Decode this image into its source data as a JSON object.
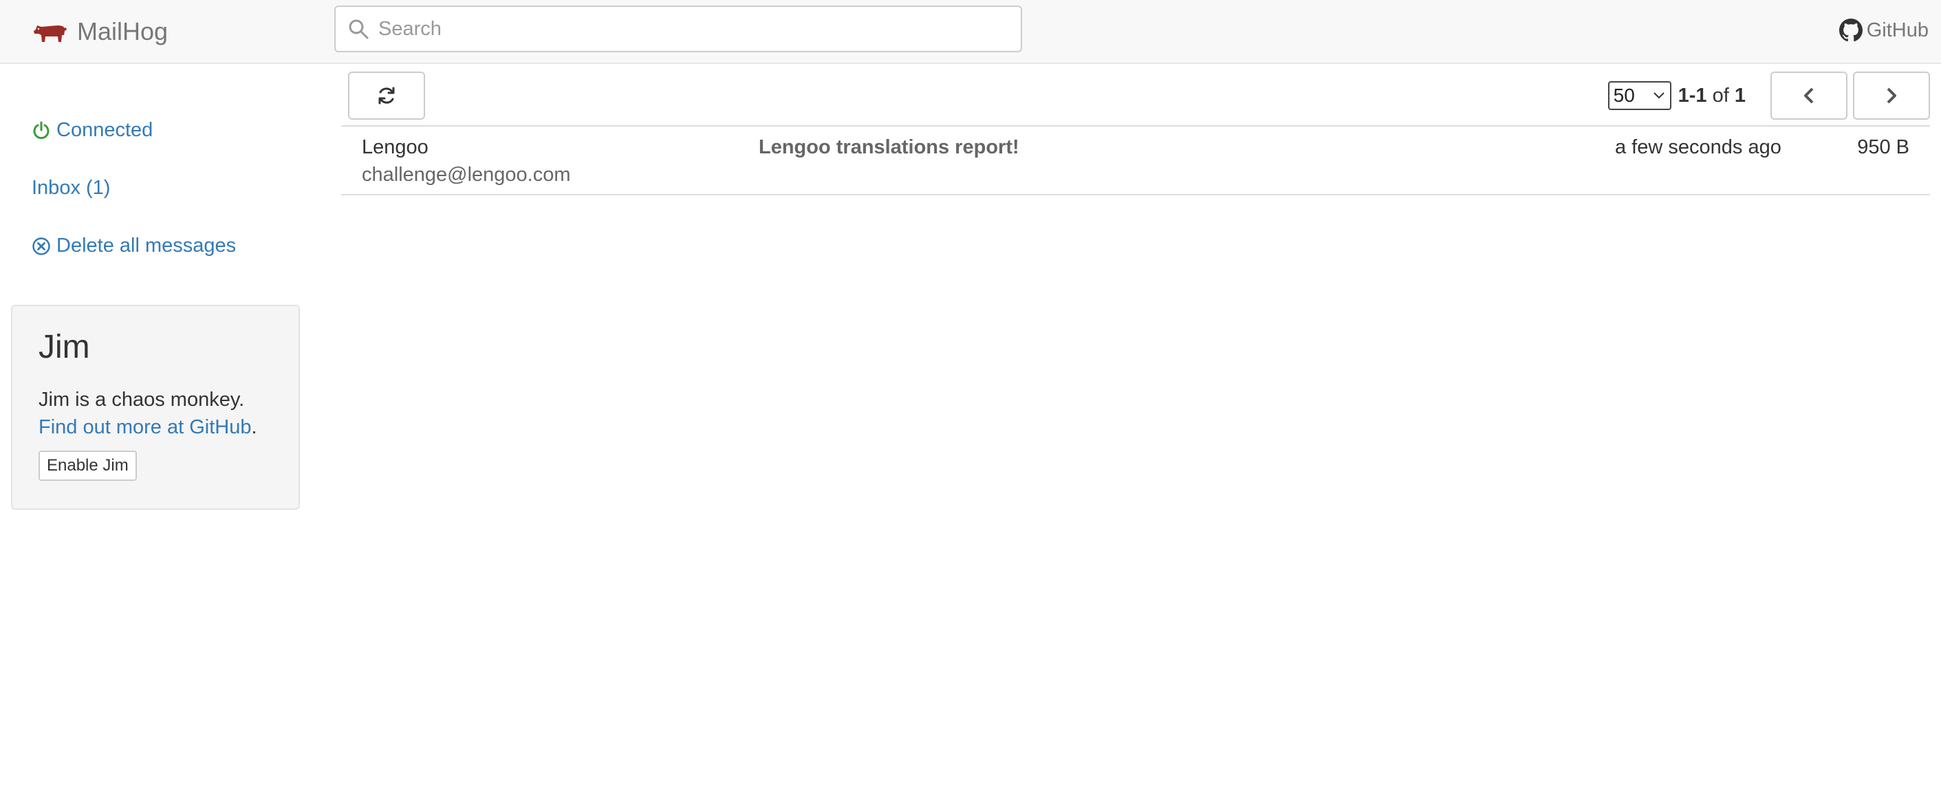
{
  "header": {
    "brand": "MailHog",
    "search_placeholder": "Search",
    "github_label": "GitHub"
  },
  "sidebar": {
    "connected_label": "Connected",
    "inbox_label": "Inbox (1)",
    "delete_all_label": "Delete all messages"
  },
  "jim": {
    "title": "Jim",
    "description": "Jim is a chaos monkey.",
    "link_text": "Find out more at GitHub",
    "link_suffix": ".",
    "button_label": "Enable Jim"
  },
  "toolbar": {
    "per_page": "50",
    "range_start_end": "1-1",
    "range_of": "of",
    "range_total": "1"
  },
  "messages": [
    {
      "from_name": "Lengoo",
      "from_email": "challenge@lengoo.com",
      "subject": "Lengoo translations report!",
      "time": "a few seconds ago",
      "size": "950 B"
    }
  ],
  "colors": {
    "link": "#337ab7",
    "connected": "#3c9a3c",
    "brand_logo": "#9b2d26"
  },
  "icons": [
    "pig-logo-icon",
    "search-icon",
    "github-icon",
    "power-icon",
    "circle-x-icon",
    "refresh-icon",
    "chevron-down-icon",
    "chevron-left-icon",
    "chevron-right-icon"
  ]
}
